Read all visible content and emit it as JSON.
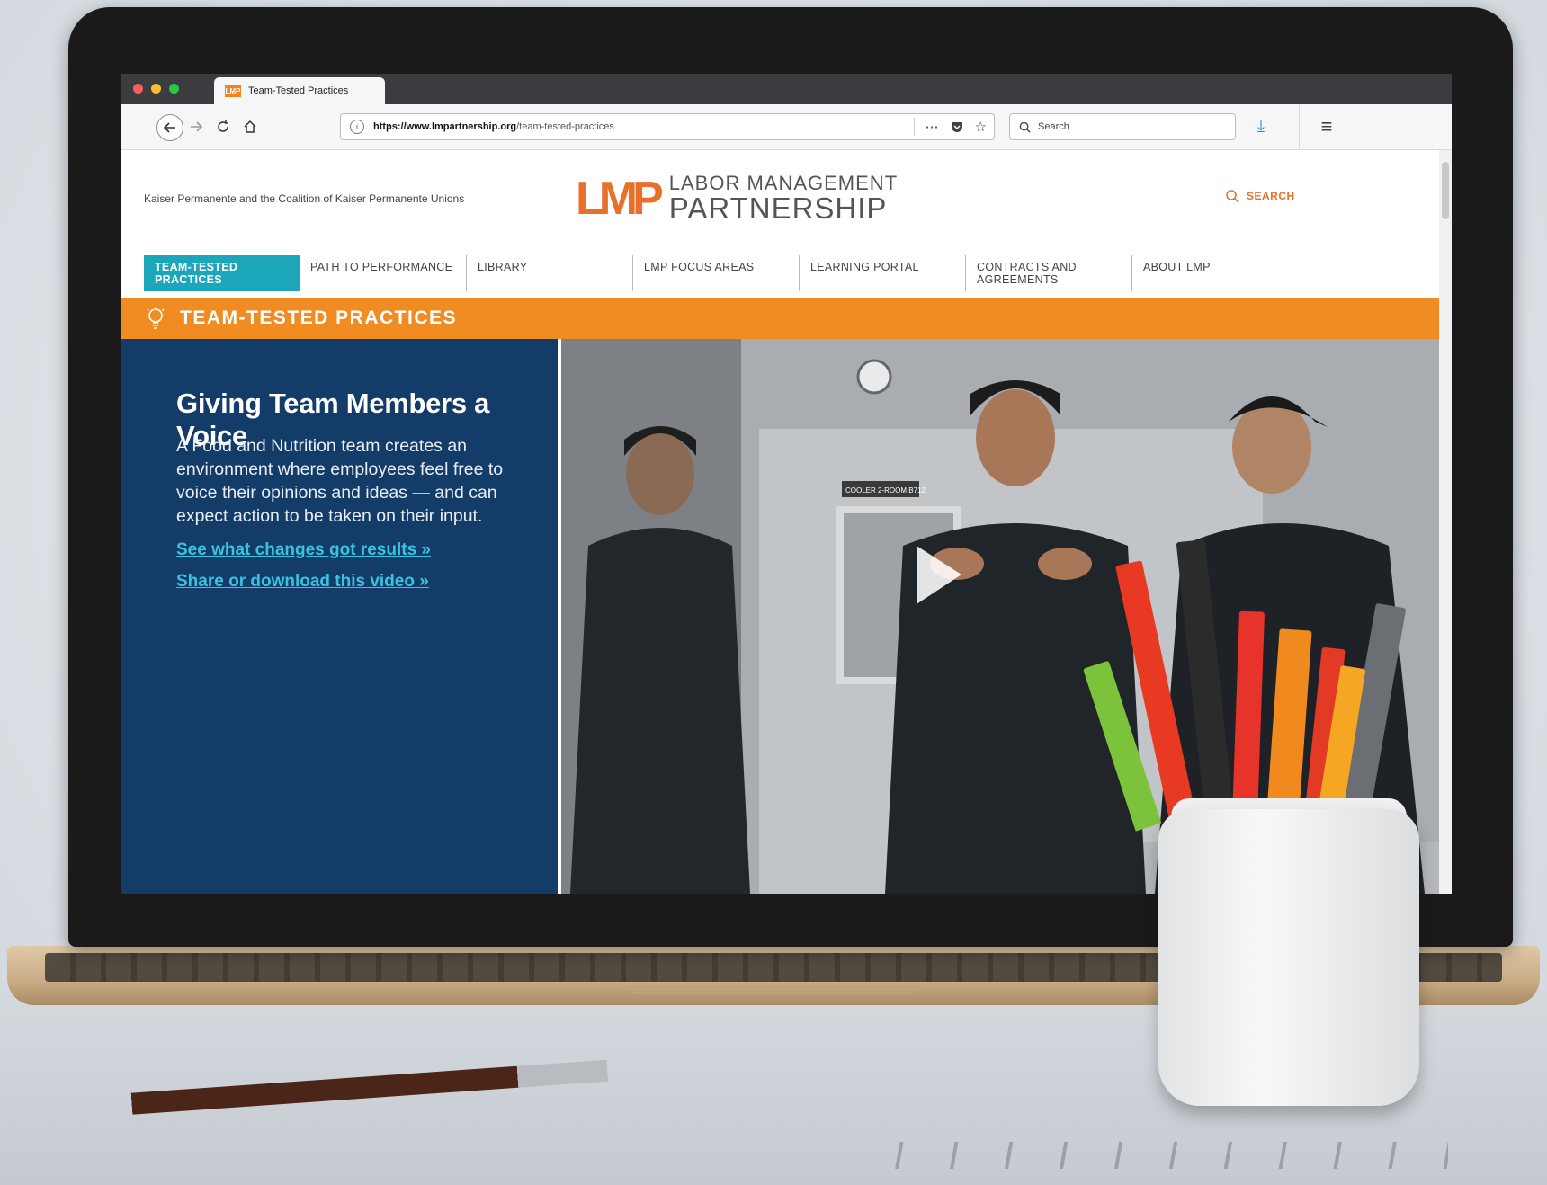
{
  "browser": {
    "tab_title": "Team-Tested Practices",
    "favicon_text": "LMP",
    "url_host": "https://www.lmpartnership.org",
    "url_path": "/team-tested-practices",
    "search_placeholder": "Search"
  },
  "site": {
    "tagline": "Kaiser Permanente and the Coalition of Kaiser Permanente Unions",
    "logo_mark": "LMP",
    "logo_line1": "LABOR MANAGEMENT",
    "logo_line2": "PARTNERSHIP",
    "search_label": "SEARCH",
    "nav": [
      {
        "label": "TEAM-TESTED PRACTICES"
      },
      {
        "label": "PATH TO PERFORMANCE"
      },
      {
        "label": "LIBRARY"
      },
      {
        "label": "LMP FOCUS AREAS"
      },
      {
        "label": "LEARNING PORTAL"
      },
      {
        "label": "CONTRACTS AND AGREEMENTS"
      },
      {
        "label": "ABOUT LMP"
      }
    ],
    "banner_title": "TEAM-TESTED PRACTICES"
  },
  "hero": {
    "title": "Giving Team Members a Voice",
    "description": "A Food and Nutrition team creates an environment where employees feel free to voice their opinions and ideas — and can expect action to be taken on their input.",
    "link1": "See what changes got results »",
    "link2": "Share or download this video »",
    "door_sign": "COOLER 2-ROOM B712"
  },
  "colors": {
    "orange": "#f08c22",
    "teal": "#1ba6b9",
    "navy": "#143c68",
    "link": "#39c3e0"
  }
}
